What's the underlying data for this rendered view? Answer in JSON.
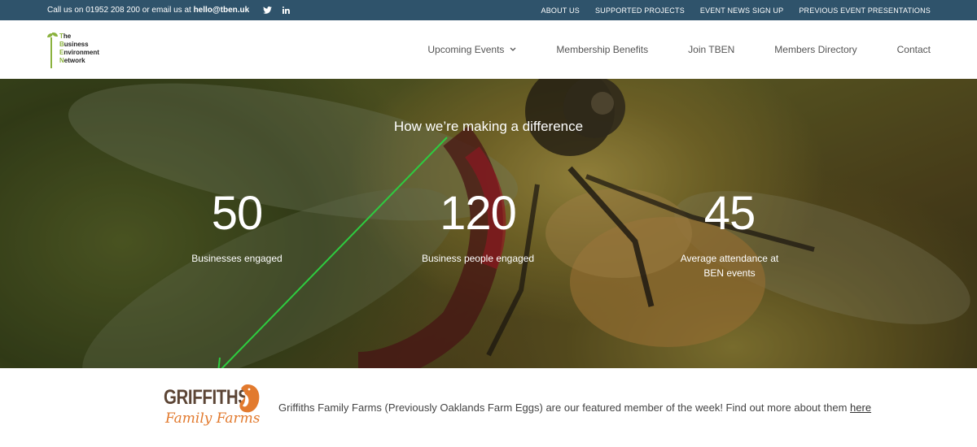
{
  "topbar": {
    "contact_text": "Call us on 01952 208 200 or email us at ",
    "email": "hello@tben.uk",
    "social": [
      "twitter-icon",
      "linkedin-icon"
    ],
    "links": [
      "ABOUT US",
      "SUPPORTED PROJECTS",
      "EVENT NEWS SIGN UP",
      "PREVIOUS EVENT PRESENTATIONS"
    ],
    "background": "#2f536b"
  },
  "logo": {
    "line1_initial": "T",
    "line1_rest": "he",
    "line2_initial": "B",
    "line2_rest": "usiness",
    "line3_initial": "E",
    "line3_rest": "nvironment",
    "line4_initial": "N",
    "line4_rest": "etwork",
    "accent": "#8bb23f"
  },
  "nav": {
    "items": [
      "Upcoming Events",
      "Membership Benefits",
      "Join TBEN",
      "Members Directory",
      "Contact"
    ]
  },
  "hero": {
    "heading": "How we’re making a difference",
    "stats": [
      {
        "value": "50",
        "label": "Businesses engaged"
      },
      {
        "value": "120",
        "label": "Business people engaged"
      },
      {
        "value": "45",
        "label_line1": "Average attendance at",
        "label_line2": "BEN events"
      }
    ]
  },
  "featured": {
    "logo_line1": "GRIFFITHS",
    "logo_line2": "Family Farms",
    "text": "Griffiths Family Farms (Previously Oaklands Farm Eggs) are our featured member of the week! Find out more about them ",
    "link": "here"
  },
  "colors": {
    "annotation_arrow": "#2ecc40",
    "brand_orange": "#e27a2e",
    "brand_brown": "#5c4535"
  }
}
